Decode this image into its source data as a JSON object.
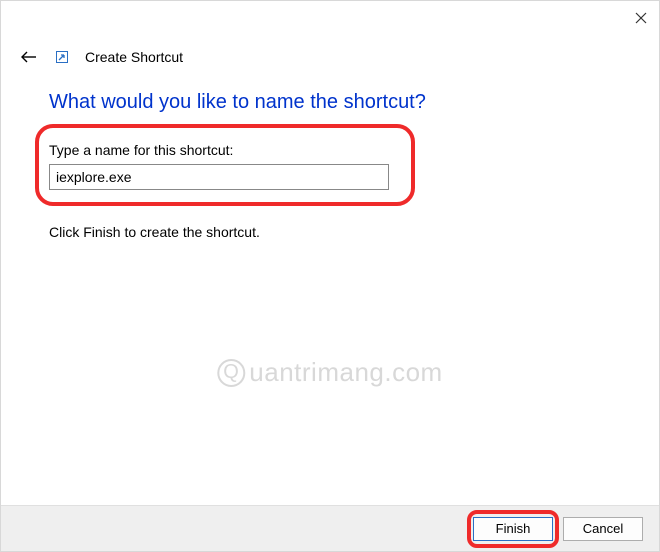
{
  "header": {
    "title": "Create Shortcut"
  },
  "main": {
    "heading": "What would you like to name the shortcut?",
    "name_label": "Type a name for this shortcut:",
    "name_value": "iexplore.exe",
    "instruction": "Click Finish to create the shortcut."
  },
  "footer": {
    "finish_label": "Finish",
    "cancel_label": "Cancel"
  },
  "watermark": {
    "text": "uantrimang.com"
  }
}
